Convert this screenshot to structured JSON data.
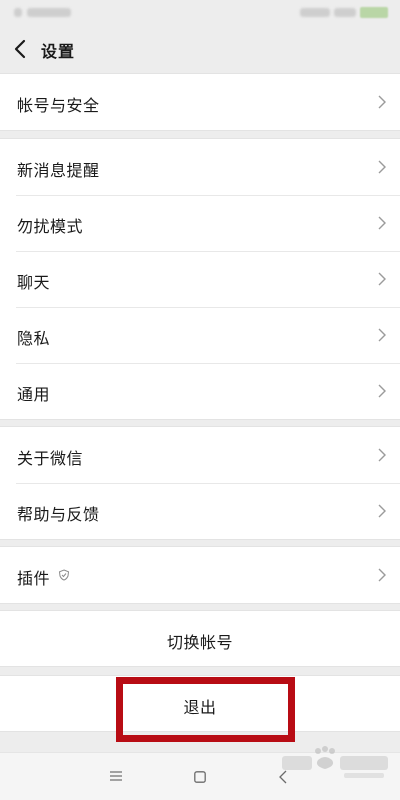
{
  "header": {
    "title": "设置"
  },
  "groups": [
    {
      "items": [
        {
          "label": "帐号与安全"
        }
      ]
    },
    {
      "items": [
        {
          "label": "新消息提醒"
        },
        {
          "label": "勿扰模式"
        },
        {
          "label": "聊天"
        },
        {
          "label": "隐私"
        },
        {
          "label": "通用"
        }
      ]
    },
    {
      "items": [
        {
          "label": "关于微信"
        },
        {
          "label": "帮助与反馈"
        }
      ]
    },
    {
      "items": [
        {
          "label": "插件",
          "icon": "shield-icon"
        }
      ]
    }
  ],
  "actions": {
    "switch_account": "切换帐号",
    "logout": "退出"
  },
  "colors": {
    "background": "#ededed",
    "highlight": "#b80c14"
  }
}
